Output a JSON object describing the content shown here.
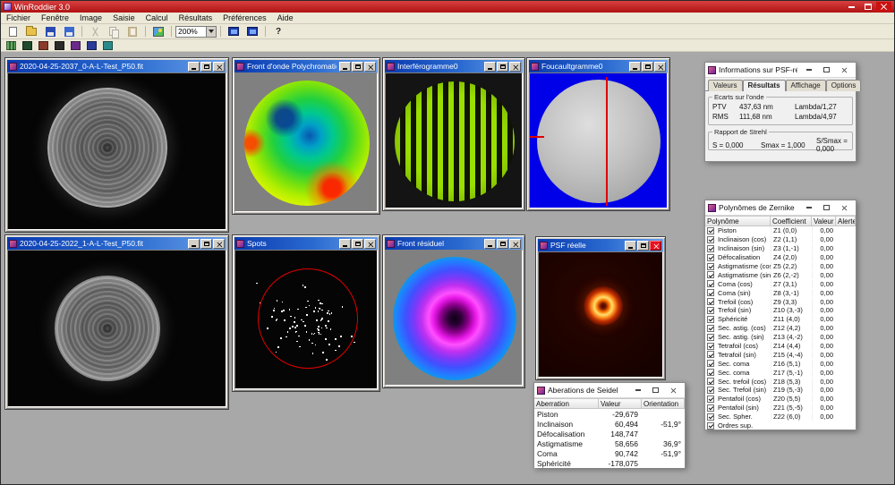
{
  "window": {
    "title": "WinRoddier 3.0"
  },
  "menubar": {
    "items": [
      "Fichier",
      "Fenêtre",
      "Image",
      "Saisie",
      "Calcul",
      "Résultats",
      "Préférences",
      "Aide"
    ]
  },
  "toolbar": {
    "zoom_value": "200%",
    "help_label": "?"
  },
  "windows": {
    "fit1": {
      "title": "2020-04-25-2037_0-A-L-Test_P50.fit"
    },
    "fit2": {
      "title": "2020-04-25-2022_1-A-L-Test_P50.fit"
    },
    "wavefront": {
      "title": "Front d'onde Polychromatique"
    },
    "interferogram": {
      "title": "Interférogramme0"
    },
    "foucault": {
      "title": "Foucaultgramme0"
    },
    "spots": {
      "title": "Spots"
    },
    "residual": {
      "title": "Front résiduel"
    },
    "psf": {
      "title": "PSF réelle"
    },
    "seidel": {
      "title": "Aberations de Seidel",
      "headers": [
        "Aberration",
        "Valeur",
        "Orientation"
      ],
      "rows": [
        [
          "Piston",
          "-29,679",
          ""
        ],
        [
          "Inclinaison",
          "60,494",
          "-51,9°"
        ],
        [
          "Défocalisation",
          "148,747",
          ""
        ],
        [
          "Astigmatisme",
          "58,656",
          "36,9°"
        ],
        [
          "Coma",
          "90,742",
          "-51,9°"
        ],
        [
          "Sphéricité",
          "-178,075",
          ""
        ]
      ]
    },
    "infos": {
      "title": "Informations sur PSF-réelle Po...",
      "tabs": [
        "Valeurs",
        "Résultats",
        "Affichage",
        "Options"
      ],
      "active_tab": "Résultats",
      "ecarts_label": "Ecarts sur l'onde",
      "ecarts_rows": [
        {
          "name": "PTV",
          "value": "437,63 nm",
          "lambda": "Lambda/1,27"
        },
        {
          "name": "RMS",
          "value": "111,68 nm",
          "lambda": "Lambda/4,97"
        }
      ],
      "strehl_label": "Rapport de Strehl",
      "strehl_s": "S = 0,000",
      "strehl_smax": "Smax = 1,000",
      "strehl_ratio": "S/Smax = 0,000"
    },
    "zernike": {
      "title": "Polynômes de Zernike",
      "headers": [
        "Polynôme",
        "Coefficient",
        "Valeur",
        "Alerte"
      ],
      "rows": [
        {
          "name": "Piston",
          "coef": "Z1 (0,0)",
          "value": "0,00"
        },
        {
          "name": "Inclinaison (cos)",
          "coef": "Z2 (1,1)",
          "value": "0,00"
        },
        {
          "name": "Inclinaison (sin)",
          "coef": "Z3 (1,-1)",
          "value": "0,00"
        },
        {
          "name": "Défocalisation",
          "coef": "Z4 (2,0)",
          "value": "0,00"
        },
        {
          "name": "Astigmatisme (cos)",
          "coef": "Z5 (2,2)",
          "value": "0,00"
        },
        {
          "name": "Astigmatisme (sin)",
          "coef": "Z6 (2,-2)",
          "value": "0,00"
        },
        {
          "name": "Coma (cos)",
          "coef": "Z7 (3,1)",
          "value": "0,00"
        },
        {
          "name": "Coma (sin)",
          "coef": "Z8 (3,-1)",
          "value": "0,00"
        },
        {
          "name": "Trefoil (cos)",
          "coef": "Z9 (3,3)",
          "value": "0,00"
        },
        {
          "name": "Trefoil (sin)",
          "coef": "Z10 (3,-3)",
          "value": "0,00"
        },
        {
          "name": "Sphéricité",
          "coef": "Z11 (4,0)",
          "value": "0,00"
        },
        {
          "name": "Sec. astig. (cos)",
          "coef": "Z12 (4,2)",
          "value": "0,00"
        },
        {
          "name": "Sec. astig. (sin)",
          "coef": "Z13 (4,-2)",
          "value": "0,00"
        },
        {
          "name": "Tetrafoil (cos)",
          "coef": "Z14 (4,4)",
          "value": "0,00"
        },
        {
          "name": "Tetrafoil (sin)",
          "coef": "Z15 (4,-4)",
          "value": "0,00"
        },
        {
          "name": "Sec. coma",
          "coef": "Z16 (5,1)",
          "value": "0,00"
        },
        {
          "name": "Sec. coma",
          "coef": "Z17 (5,-1)",
          "value": "0,00"
        },
        {
          "name": "Sec. trefoil (cos)",
          "coef": "Z18 (5,3)",
          "value": "0,00"
        },
        {
          "name": "Sec. Trefoil (sin)",
          "coef": "Z19 (5,-3)",
          "value": "0,00"
        },
        {
          "name": "Pentafoil (cos)",
          "coef": "Z20 (5,5)",
          "value": "0,00"
        },
        {
          "name": "Pentafoil (sin)",
          "coef": "Z21 (5,-5)",
          "value": "0,00"
        },
        {
          "name": "Sec. Spher.",
          "coef": "Z22 (6,0)",
          "value": "0,00"
        }
      ],
      "footer": "Ordres sup."
    }
  }
}
